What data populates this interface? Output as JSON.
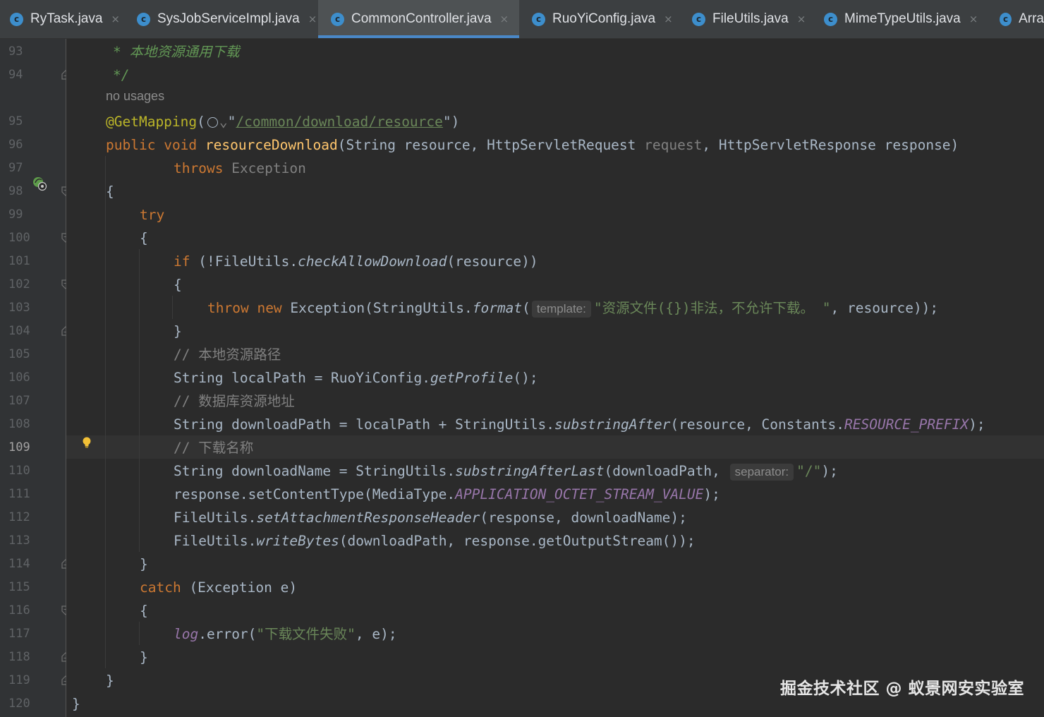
{
  "tabs": [
    {
      "label": "RyTask.java",
      "close": "×",
      "active": false
    },
    {
      "label": "SysJobServiceImpl.java",
      "close": "×",
      "active": false
    },
    {
      "label": "CommonController.java",
      "close": "×",
      "active": true
    },
    {
      "label": "RuoYiConfig.java",
      "close": "×",
      "active": false
    },
    {
      "label": "FileUtils.java",
      "close": "×",
      "active": false
    },
    {
      "label": "MimeTypeUtils.java",
      "close": "×",
      "active": false
    },
    {
      "label": "Arra",
      "close": "",
      "active": false
    }
  ],
  "tab_icon_letter": "c",
  "gutter": {
    "lines": [
      "93",
      "94",
      "",
      "95",
      "96",
      "97",
      "98",
      "99",
      "100",
      "101",
      "102",
      "103",
      "104",
      "105",
      "106",
      "107",
      "108",
      "109",
      "110",
      "111",
      "112",
      "113",
      "114",
      "115",
      "116",
      "117",
      "118",
      "119",
      "120"
    ],
    "current_line": "109"
  },
  "code": {
    "doc_line": "* 本地资源通用下载",
    "doc_end": "*/",
    "usages": "no usages",
    "annotation": "@GetMapping",
    "mapping_path": "/common/download/resource",
    "kw_public": "public",
    "kw_void": "void",
    "method_name": "resourceDownload",
    "params": "(String resource, HttpServletRequest ",
    "param_request": "request",
    "params_tail": ", HttpServletResponse response)",
    "kw_throws": "throws",
    "throws_type": "Exception",
    "brace_open": "{",
    "brace_close": "}",
    "kw_try": "try",
    "kw_if": "if",
    "if_pre": " (!FileUtils.",
    "if_method": "checkAllowDownload",
    "if_post": "(resource))",
    "kw_throw": "throw",
    "kw_new": "new",
    "throw_mid": " Exception(StringUtils.",
    "throw_method": "format",
    "hint_template": "template:",
    "throw_string": "\"资源文件({})非法，不允许下载。 \"",
    "throw_tail": ", resource));",
    "comment_local": "// 本地资源路径",
    "local_pre": "String localPath = RuoYiConfig.",
    "local_method": "getProfile",
    "local_post": "();",
    "comment_db": "// 数据库资源地址",
    "dl_pre": "String downloadPath = localPath + StringUtils.",
    "dl_method": "substringAfter",
    "dl_mid": "(resource, Constants.",
    "dl_const": "RESOURCE_PREFIX",
    "dl_post": ");",
    "comment_name": "// 下载名称",
    "name_pre": "String downloadName = StringUtils.",
    "name_method": "substringAfterLast",
    "name_mid": "(downloadPath, ",
    "hint_separator": "separator:",
    "name_string": "\"/\"",
    "name_post": ");",
    "ct_pre": "response.setContentType(MediaType.",
    "ct_const": "APPLICATION_OCTET_STREAM_VALUE",
    "ct_post": ");",
    "hdr_pre": "FileUtils.",
    "hdr_method": "setAttachmentResponseHeader",
    "hdr_post": "(response, downloadName);",
    "wb_pre": "FileUtils.",
    "wb_method": "writeBytes",
    "wb_post": "(downloadPath, response.getOutputStream());",
    "kw_catch": "catch",
    "catch_post": " (Exception e)",
    "log_var": "log",
    "log_mid": ".error(",
    "log_string": "\"下载文件失败\"",
    "log_post": ", e);"
  },
  "watermark": "掘金技术社区 @ 蚁景网安实验室",
  "colors": {
    "background": "#2b2b2b",
    "keyword": "#cc7832",
    "string": "#6a8759",
    "method": "#ffc66d",
    "constant": "#9876aa",
    "annotation": "#bbb529",
    "tab_underline": "#4a88c7"
  }
}
